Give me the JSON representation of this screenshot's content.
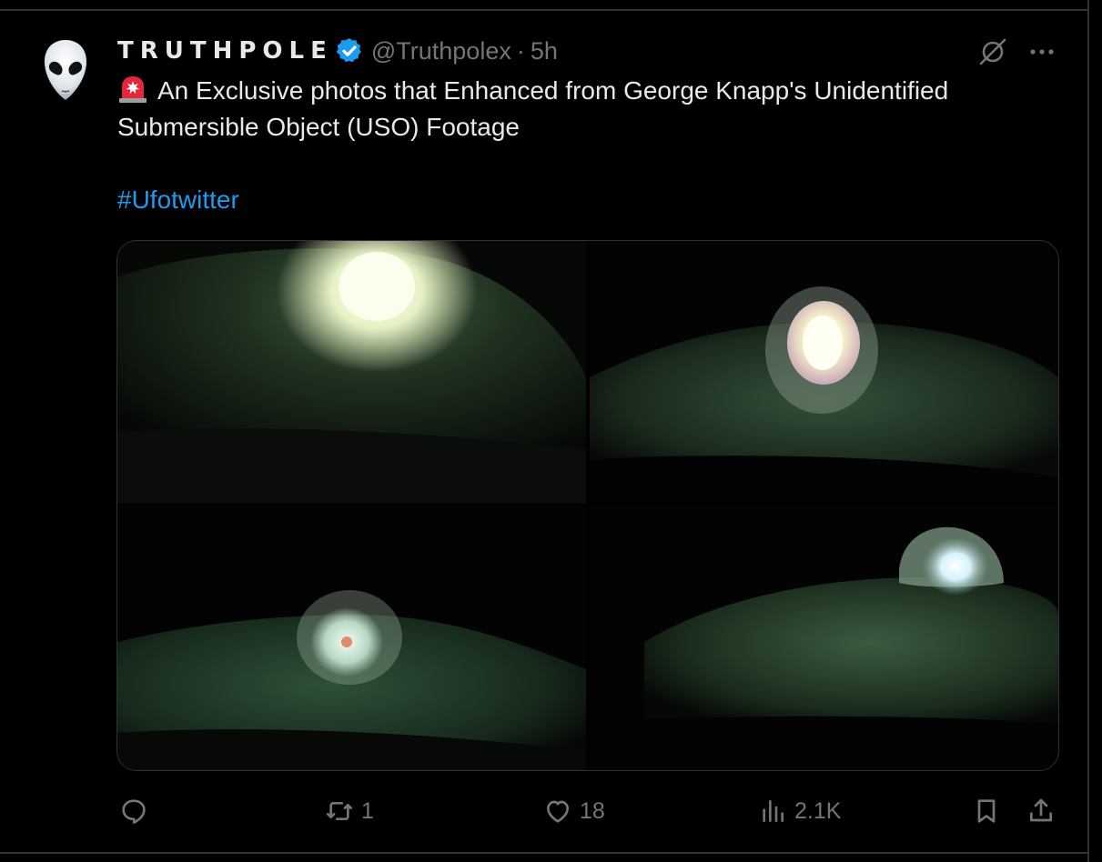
{
  "author": {
    "display_name": "TRUTHPOLE",
    "handle": "@Truthpolex",
    "separator": "·",
    "time": "5h",
    "avatar_icon": "alien-head-icon",
    "verified_color": "#1d9bf0"
  },
  "tweet": {
    "siren_icon": "rotating-light-emoji",
    "text": "An Exclusive photos that Enhanced from George Knapp's Unidentified Submersible Object (USO) Footage",
    "hashtag": "#Ufotwitter"
  },
  "media": {
    "layout": "2x2-grid",
    "count": 4
  },
  "actions": {
    "reply_count": "",
    "retweet_count": "1",
    "like_count": "18",
    "views_count": "2.1K"
  },
  "colors": {
    "background": "#000000",
    "text": "#e7e9ea",
    "muted": "#71767b",
    "link": "#1d9bf0",
    "border": "#2f3336"
  }
}
